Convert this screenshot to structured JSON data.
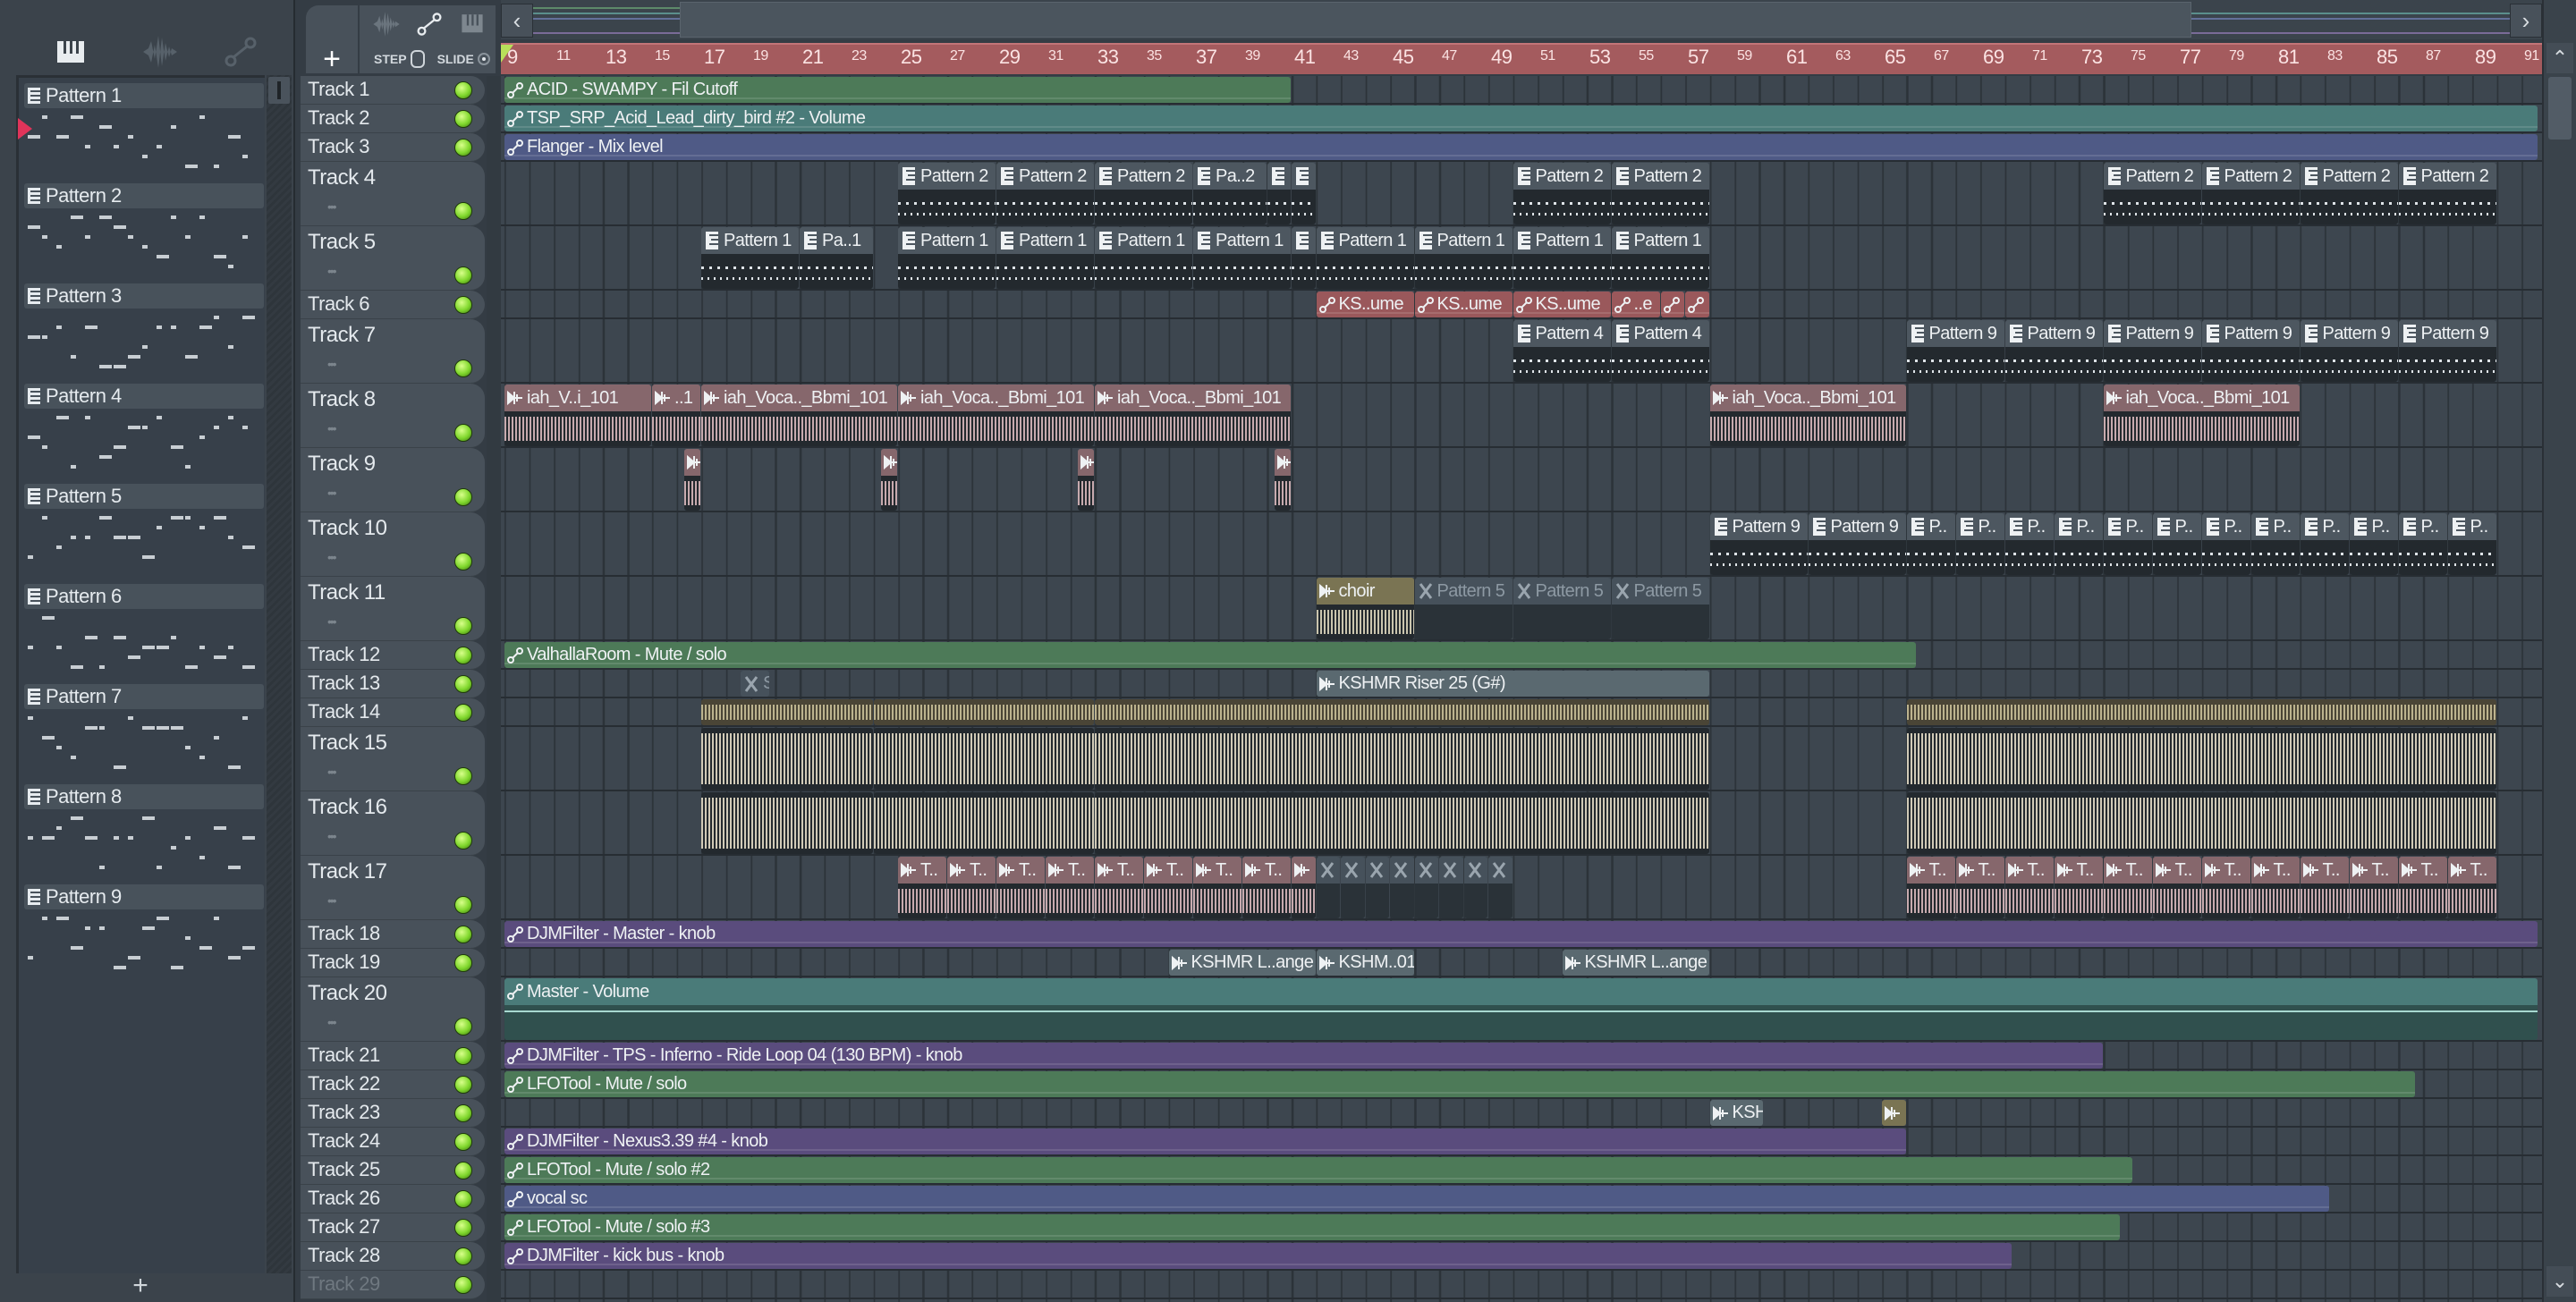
{
  "toolbar": {
    "add_label": "+",
    "step_label": "STEP",
    "slide_label": "SLIDE"
  },
  "picker": {
    "add_label": "+",
    "patterns": [
      {
        "label": "Pattern 1"
      },
      {
        "label": "Pattern 2"
      },
      {
        "label": "Pattern 3"
      },
      {
        "label": "Pattern 4"
      },
      {
        "label": "Pattern 5"
      },
      {
        "label": "Pattern 6"
      },
      {
        "label": "Pattern 7"
      },
      {
        "label": "Pattern 8"
      },
      {
        "label": "Pattern 9"
      }
    ]
  },
  "overview": {
    "left_arrow": "‹",
    "right_arrow": "›"
  },
  "scroll": {
    "up": "⌃",
    "down": "⌄"
  },
  "ruler": {
    "bars": [
      9,
      11,
      13,
      15,
      17,
      19,
      21,
      23,
      25,
      27,
      29,
      31,
      33,
      35,
      37,
      39,
      41,
      43,
      45,
      47,
      49,
      51,
      53,
      55,
      57,
      59,
      61,
      63,
      65,
      67,
      69,
      71,
      73,
      75,
      77,
      79,
      81,
      83,
      85,
      87,
      89,
      91
    ]
  },
  "colors": {
    "green": "#4d7a58",
    "teal": "#4a7b79",
    "blue": "#4f5a86",
    "purple": "#5a4c7d",
    "red": "#9a585b",
    "pink": "#86676c",
    "tan": "#7a7453",
    "slate": "#5a6970",
    "olive": "#77704f",
    "cream": "#3a3f3f",
    "led": "#8fe23a",
    "ruler": "#a45b5e"
  },
  "tracks": [
    {
      "name": "Track 1",
      "clips": [
        {
          "k": "auto",
          "c": "green",
          "label": "ACID - SWAMPY - Fil Cutoff",
          "s": 9,
          "l": 32
        }
      ]
    },
    {
      "name": "Track 2",
      "clips": [
        {
          "k": "auto",
          "c": "teal",
          "label": "TSP_SRP_Acid_Lead_dirty_bird #2 - Volume",
          "s": 9,
          "l": 82.7
        }
      ]
    },
    {
      "name": "Track 3",
      "clips": [
        {
          "k": "auto",
          "c": "blue",
          "label": "Flanger - Mix level",
          "s": 9,
          "l": 82.7
        }
      ]
    },
    {
      "name": "Track 4",
      "clips": [
        {
          "k": "pattern",
          "label": "Pattern 2",
          "s": 25,
          "l": 4
        },
        {
          "k": "pattern",
          "label": "Pattern 2",
          "s": 29,
          "l": 4
        },
        {
          "k": "pattern",
          "label": "Pattern 2",
          "s": 33,
          "l": 4
        },
        {
          "k": "pattern",
          "label": "Pa..2",
          "s": 37,
          "l": 3
        },
        {
          "k": "pattern",
          "label": "",
          "s": 40,
          "l": 1
        },
        {
          "k": "pattern",
          "label": "",
          "s": 41,
          "l": 1
        },
        {
          "k": "pattern",
          "label": "Pattern 2",
          "s": 50,
          "l": 4
        },
        {
          "k": "pattern",
          "label": "Pattern 2",
          "s": 54,
          "l": 4
        },
        {
          "k": "pattern",
          "label": "Pattern 2",
          "s": 74,
          "l": 4
        },
        {
          "k": "pattern",
          "label": "Pattern 2",
          "s": 78,
          "l": 4
        },
        {
          "k": "pattern",
          "label": "Pattern 2",
          "s": 82,
          "l": 4
        },
        {
          "k": "pattern",
          "label": "Pattern 2",
          "s": 86,
          "l": 4
        }
      ]
    },
    {
      "name": "Track 5",
      "clips": [
        {
          "k": "pattern",
          "label": "Pattern 1",
          "s": 17,
          "l": 4
        },
        {
          "k": "pattern",
          "label": "Pa..1",
          "s": 21,
          "l": 3
        },
        {
          "k": "pattern",
          "label": "Pattern 1",
          "s": 25,
          "l": 4
        },
        {
          "k": "pattern",
          "label": "Pattern 1",
          "s": 29,
          "l": 4
        },
        {
          "k": "pattern",
          "label": "Pattern 1",
          "s": 33,
          "l": 4
        },
        {
          "k": "pattern",
          "label": "Pattern 1",
          "s": 37,
          "l": 4
        },
        {
          "k": "pattern",
          "label": "",
          "s": 41,
          "l": 1
        },
        {
          "k": "pattern",
          "label": "Pattern 1",
          "s": 42,
          "l": 4
        },
        {
          "k": "pattern",
          "label": "Pattern 1",
          "s": 46,
          "l": 4
        },
        {
          "k": "pattern",
          "label": "Pattern 1",
          "s": 50,
          "l": 4
        },
        {
          "k": "pattern",
          "label": "Pattern 1",
          "s": 54,
          "l": 4
        }
      ]
    },
    {
      "name": "Track 6",
      "clips": [
        {
          "k": "auto",
          "c": "red",
          "label": "KS..ume",
          "s": 42,
          "l": 4
        },
        {
          "k": "auto",
          "c": "red",
          "label": "KS..ume",
          "s": 46,
          "l": 4
        },
        {
          "k": "auto",
          "c": "red",
          "label": "KS..ume",
          "s": 50,
          "l": 4
        },
        {
          "k": "auto",
          "c": "red",
          "label": "..e",
          "s": 54,
          "l": 2
        },
        {
          "k": "auto",
          "c": "red",
          "label": "",
          "s": 56,
          "l": 1
        },
        {
          "k": "auto",
          "c": "red",
          "label": "",
          "s": 57,
          "l": 1
        }
      ]
    },
    {
      "name": "Track 7",
      "clips": [
        {
          "k": "pattern",
          "label": "Pattern 4",
          "s": 50,
          "l": 4
        },
        {
          "k": "pattern",
          "label": "Pattern 4",
          "s": 54,
          "l": 4
        },
        {
          "k": "pattern",
          "label": "Pattern 9",
          "s": 66,
          "l": 4
        },
        {
          "k": "pattern",
          "label": "Pattern 9",
          "s": 70,
          "l": 4
        },
        {
          "k": "pattern",
          "label": "Pattern 9",
          "s": 74,
          "l": 4
        },
        {
          "k": "pattern",
          "label": "Pattern 9",
          "s": 78,
          "l": 4
        },
        {
          "k": "pattern",
          "label": "Pattern 9",
          "s": 82,
          "l": 4
        },
        {
          "k": "pattern",
          "label": "Pattern 9",
          "s": 86,
          "l": 4
        }
      ]
    },
    {
      "name": "Track 8",
      "clips": [
        {
          "k": "audio",
          "c": "pink",
          "label": "iah_V..i_101",
          "s": 9,
          "l": 6
        },
        {
          "k": "audio",
          "c": "pink",
          "label": "..1",
          "s": 15,
          "l": 2
        },
        {
          "k": "audio",
          "c": "pink",
          "label": "iah_Voca.._Bbmi_101",
          "s": 17,
          "l": 8
        },
        {
          "k": "audio",
          "c": "pink",
          "label": "iah_Voca.._Bbmi_101",
          "s": 25,
          "l": 8
        },
        {
          "k": "audio",
          "c": "pink",
          "label": "iah_Voca.._Bbmi_101",
          "s": 33,
          "l": 8
        },
        {
          "k": "audio",
          "c": "pink",
          "label": "iah_Voca.._Bbmi_101",
          "s": 58,
          "l": 8
        },
        {
          "k": "audio",
          "c": "pink",
          "label": "iah_Voca.._Bbmi_101",
          "s": 74,
          "l": 8
        }
      ]
    },
    {
      "name": "Track 9",
      "clips": [
        {
          "k": "audio",
          "c": "pink",
          "label": "",
          "s": 16.3,
          "l": 0.7
        },
        {
          "k": "audio",
          "c": "pink",
          "label": "",
          "s": 24.3,
          "l": 0.7
        },
        {
          "k": "audio",
          "c": "pink",
          "label": "",
          "s": 32.3,
          "l": 0.7
        },
        {
          "k": "audio",
          "c": "pink",
          "label": "",
          "s": 40.3,
          "l": 0.7
        }
      ]
    },
    {
      "name": "Track 10",
      "clips": [
        {
          "k": "pattern",
          "label": "Pattern 9",
          "s": 58,
          "l": 4
        },
        {
          "k": "pattern",
          "label": "Pattern 9",
          "s": 62,
          "l": 4
        },
        {
          "k": "pattern",
          "label": "P..",
          "s": 66,
          "l": 2
        },
        {
          "k": "pattern",
          "label": "P..",
          "s": 68,
          "l": 2
        },
        {
          "k": "pattern",
          "label": "P..",
          "s": 70,
          "l": 2
        },
        {
          "k": "pattern",
          "label": "P..",
          "s": 72,
          "l": 2
        },
        {
          "k": "pattern",
          "label": "P..",
          "s": 74,
          "l": 2
        },
        {
          "k": "pattern",
          "label": "P..",
          "s": 76,
          "l": 2
        },
        {
          "k": "pattern",
          "label": "P..",
          "s": 78,
          "l": 2
        },
        {
          "k": "pattern",
          "label": "P..",
          "s": 80,
          "l": 2
        },
        {
          "k": "pattern",
          "label": "P..",
          "s": 82,
          "l": 2
        },
        {
          "k": "pattern",
          "label": "P..",
          "s": 84,
          "l": 2
        },
        {
          "k": "pattern",
          "label": "P..",
          "s": 86,
          "l": 2
        },
        {
          "k": "pattern",
          "label": "P..",
          "s": 88,
          "l": 2
        }
      ]
    },
    {
      "name": "Track 11",
      "clips": [
        {
          "k": "audio",
          "c": "tan",
          "label": "choir",
          "s": 42,
          "l": 4
        },
        {
          "k": "muted",
          "label": "Pattern 5",
          "s": 46,
          "l": 4
        },
        {
          "k": "muted",
          "label": "Pattern 5",
          "s": 50,
          "l": 4
        },
        {
          "k": "muted",
          "label": "Pattern 5",
          "s": 54,
          "l": 4
        }
      ]
    },
    {
      "name": "Track 12",
      "clips": [
        {
          "k": "auto",
          "c": "green",
          "label": "ValhallaRoom - Mute / solo",
          "s": 9,
          "l": 57.4
        }
      ]
    },
    {
      "name": "Track 13",
      "clips": [
        {
          "k": "muted",
          "label": "S..",
          "s": 18.6,
          "l": 1.2
        },
        {
          "k": "audio",
          "c": "slate",
          "label": "KSHMR Riser 25 (G#)",
          "s": 42,
          "l": 16
        }
      ]
    },
    {
      "name": "Track 14",
      "clips": [
        {
          "k": "audio",
          "c": "olive",
          "label": "",
          "s": 17,
          "l": 7
        },
        {
          "k": "audio",
          "c": "olive",
          "label": "",
          "s": 24,
          "l": 9
        },
        {
          "k": "audio",
          "c": "olive",
          "label": "",
          "s": 33,
          "l": 25
        },
        {
          "k": "audio",
          "c": "olive",
          "label": "",
          "s": 66,
          "l": 24
        }
      ]
    },
    {
      "name": "Track 15",
      "clips": [
        {
          "k": "audio",
          "c": "cream",
          "label": "",
          "s": 17,
          "l": 7
        },
        {
          "k": "audio",
          "c": "cream",
          "label": "",
          "s": 24,
          "l": 9
        },
        {
          "k": "audio",
          "c": "cream",
          "label": "",
          "s": 33,
          "l": 25
        },
        {
          "k": "audio",
          "c": "cream",
          "label": "",
          "s": 66,
          "l": 24
        }
      ]
    },
    {
      "name": "Track 16",
      "clips": [
        {
          "k": "audio",
          "c": "cream",
          "label": "",
          "s": 17,
          "l": 7
        },
        {
          "k": "audio",
          "c": "cream",
          "label": "",
          "s": 24,
          "l": 9
        },
        {
          "k": "audio",
          "c": "cream",
          "label": "",
          "s": 33,
          "l": 25
        },
        {
          "k": "audio",
          "c": "cream",
          "label": "",
          "s": 66,
          "l": 24
        }
      ]
    },
    {
      "name": "Track 17",
      "clips": [
        {
          "k": "audio",
          "c": "pink",
          "label": "T..",
          "s": 25,
          "l": 2
        },
        {
          "k": "audio",
          "c": "pink",
          "label": "T..",
          "s": 27,
          "l": 2
        },
        {
          "k": "audio",
          "c": "pink",
          "label": "T..",
          "s": 29,
          "l": 2
        },
        {
          "k": "audio",
          "c": "pink",
          "label": "T..",
          "s": 31,
          "l": 2
        },
        {
          "k": "audio",
          "c": "pink",
          "label": "T..",
          "s": 33,
          "l": 2
        },
        {
          "k": "audio",
          "c": "pink",
          "label": "T..",
          "s": 35,
          "l": 2
        },
        {
          "k": "audio",
          "c": "pink",
          "label": "T..",
          "s": 37,
          "l": 2
        },
        {
          "k": "audio",
          "c": "pink",
          "label": "T..",
          "s": 39,
          "l": 2
        },
        {
          "k": "audio",
          "c": "pink",
          "label": "",
          "s": 41,
          "l": 1
        },
        {
          "k": "muted",
          "label": "",
          "s": 42,
          "l": 1
        },
        {
          "k": "muted",
          "label": "",
          "s": 43,
          "l": 1
        },
        {
          "k": "muted",
          "label": "",
          "s": 44,
          "l": 1
        },
        {
          "k": "muted",
          "label": "",
          "s": 45,
          "l": 1
        },
        {
          "k": "muted",
          "label": "",
          "s": 46,
          "l": 1
        },
        {
          "k": "muted",
          "label": "",
          "s": 47,
          "l": 1
        },
        {
          "k": "muted",
          "label": "",
          "s": 48,
          "l": 1
        },
        {
          "k": "muted",
          "label": "",
          "s": 49,
          "l": 1
        },
        {
          "k": "audio",
          "c": "pink",
          "label": "T..",
          "s": 66,
          "l": 2
        },
        {
          "k": "audio",
          "c": "pink",
          "label": "T..",
          "s": 68,
          "l": 2
        },
        {
          "k": "audio",
          "c": "pink",
          "label": "T..",
          "s": 70,
          "l": 2
        },
        {
          "k": "audio",
          "c": "pink",
          "label": "T..",
          "s": 72,
          "l": 2
        },
        {
          "k": "audio",
          "c": "pink",
          "label": "T..",
          "s": 74,
          "l": 2
        },
        {
          "k": "audio",
          "c": "pink",
          "label": "T..",
          "s": 76,
          "l": 2
        },
        {
          "k": "audio",
          "c": "pink",
          "label": "T..",
          "s": 78,
          "l": 2
        },
        {
          "k": "audio",
          "c": "pink",
          "label": "T..",
          "s": 80,
          "l": 2
        },
        {
          "k": "audio",
          "c": "pink",
          "label": "T..",
          "s": 82,
          "l": 2
        },
        {
          "k": "audio",
          "c": "pink",
          "label": "T..",
          "s": 84,
          "l": 2
        },
        {
          "k": "audio",
          "c": "pink",
          "label": "T..",
          "s": 86,
          "l": 2
        },
        {
          "k": "audio",
          "c": "pink",
          "label": "T..",
          "s": 88,
          "l": 2
        }
      ]
    },
    {
      "name": "Track 18",
      "clips": [
        {
          "k": "auto",
          "c": "purple",
          "label": "DJMFilter - Master - knob",
          "s": 9,
          "l": 82.7
        }
      ]
    },
    {
      "name": "Track 19",
      "clips": [
        {
          "k": "audio",
          "c": "slate",
          "label": "KSHMR L..ange",
          "s": 36,
          "l": 6
        },
        {
          "k": "audio",
          "c": "slate",
          "label": "KSHM..01",
          "s": 42,
          "l": 4
        },
        {
          "k": "audio",
          "c": "slate",
          "label": "KSHMR L..ange",
          "s": 52,
          "l": 6
        }
      ]
    },
    {
      "name": "Track 20",
      "clips": [
        {
          "k": "auto",
          "c": "teal",
          "label": "Master - Volume",
          "s": 9,
          "l": 82.7
        }
      ]
    },
    {
      "name": "Track 21",
      "clips": [
        {
          "k": "auto",
          "c": "purple",
          "label": "DJMFilter - TPS - Inferno - Ride Loop 04 (130 BPM) - knob",
          "s": 9,
          "l": 65
        }
      ]
    },
    {
      "name": "Track 22",
      "clips": [
        {
          "k": "auto",
          "c": "green",
          "label": "LFOTool - Mute / solo",
          "s": 9,
          "l": 77.7
        }
      ]
    },
    {
      "name": "Track 23",
      "clips": [
        {
          "k": "audio",
          "c": "slate",
          "label": "KSHM..(A)",
          "s": 58,
          "l": 2.2
        },
        {
          "k": "audio",
          "c": "tan",
          "label": "",
          "s": 65,
          "l": 1
        }
      ]
    },
    {
      "name": "Track 24",
      "clips": [
        {
          "k": "auto",
          "c": "purple",
          "label": "DJMFilter - Nexus3.39 #4 - knob",
          "s": 9,
          "l": 57
        }
      ]
    },
    {
      "name": "Track 25",
      "clips": [
        {
          "k": "auto",
          "c": "green",
          "label": "LFOTool - Mute / solo #2",
          "s": 9,
          "l": 66.2
        }
      ]
    },
    {
      "name": "Track 26",
      "clips": [
        {
          "k": "auto",
          "c": "blue",
          "label": "vocal sc",
          "s": 9,
          "l": 74.2
        }
      ]
    },
    {
      "name": "Track 27",
      "clips": [
        {
          "k": "auto",
          "c": "green",
          "label": "LFOTool - Mute / solo #3",
          "s": 9,
          "l": 65.7
        }
      ]
    },
    {
      "name": "Track 28",
      "clips": [
        {
          "k": "auto",
          "c": "purple",
          "label": "DJMFilter - kick bus - knob",
          "s": 9,
          "l": 61.3
        }
      ]
    },
    {
      "name": "Track 29",
      "clips": []
    }
  ]
}
